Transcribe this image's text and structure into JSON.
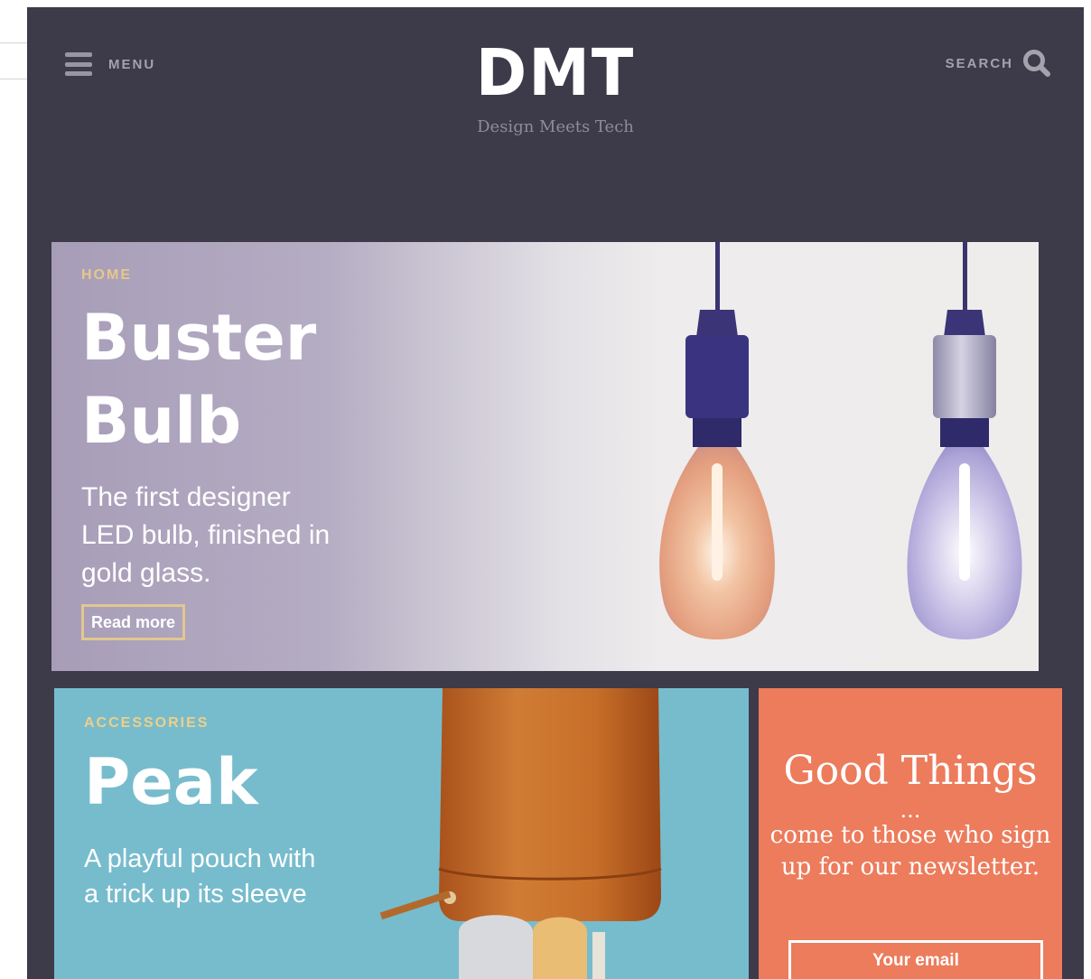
{
  "header": {
    "menu_label": "MENU",
    "logo_title": "DMT",
    "logo_subtitle": "Design Meets Tech",
    "search_label": "SEARCH"
  },
  "hero": {
    "category": "HOME",
    "title_line1": "Buster",
    "title_line2": "Bulb",
    "description": "The first designer LED bulb, finished in gold glass.",
    "cta": "Read more"
  },
  "feature": {
    "category": "ACCESSORIES",
    "title": "Peak",
    "description": "A playful pouch with a trick up its sleeve"
  },
  "newsletter": {
    "title": "Good Things",
    "ellipsis": "...",
    "body": "come to those who sign up for our newsletter.",
    "email_placeholder": "Your email"
  },
  "colors": {
    "background": "#3d3a49",
    "accent_gold": "#e6c78b",
    "feature_blue": "#77bccd",
    "newsletter_coral": "#ec7c5c"
  },
  "icons": {
    "menu": "hamburger-icon",
    "search": "magnifier-icon"
  }
}
